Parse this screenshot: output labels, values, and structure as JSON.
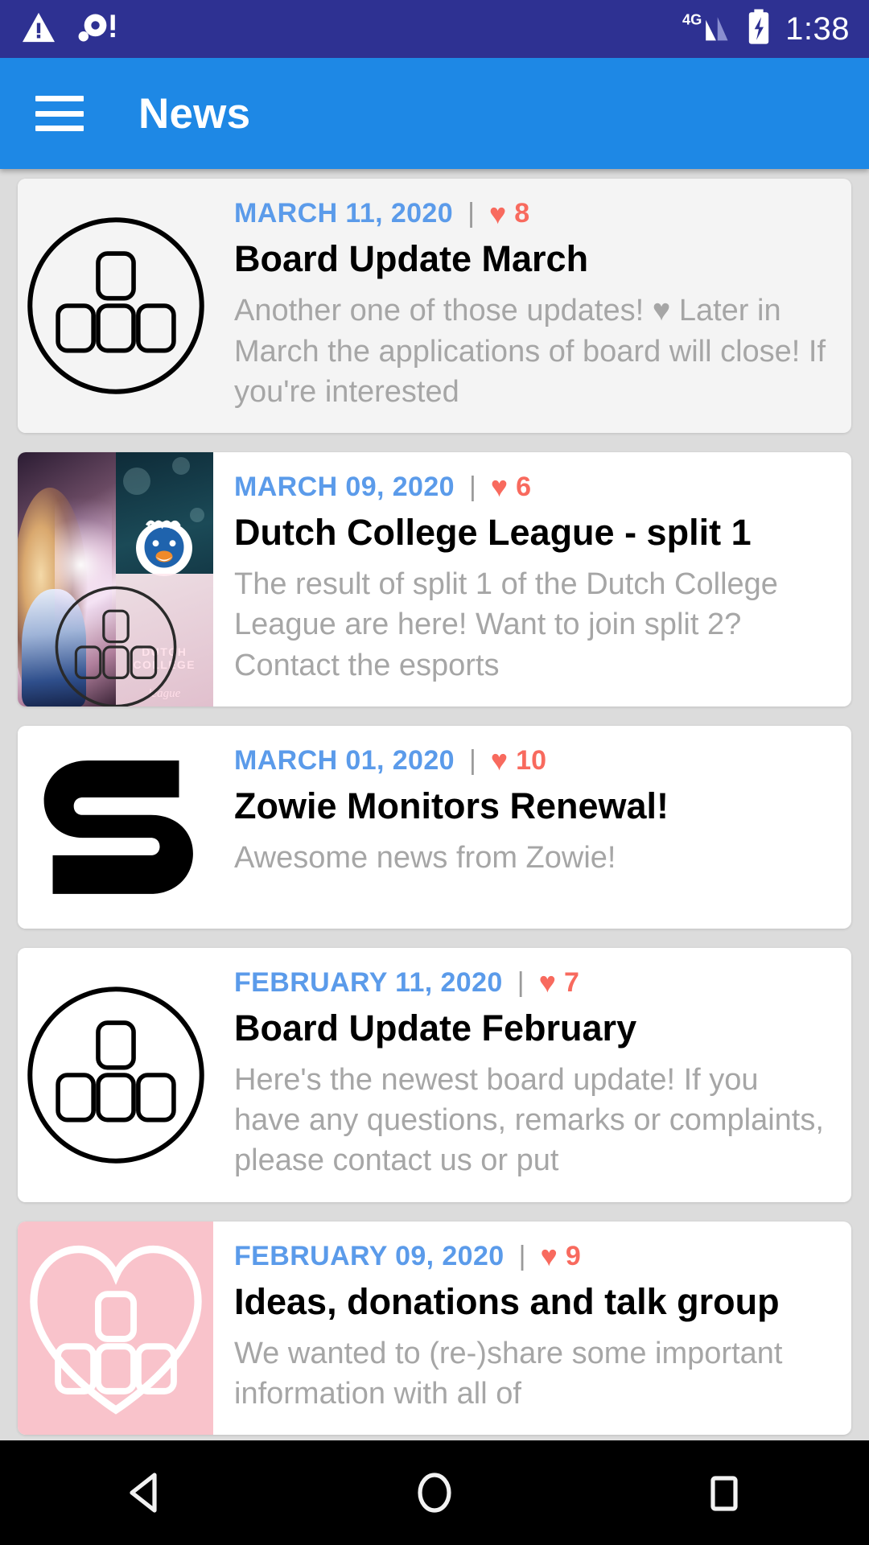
{
  "status_bar": {
    "background": "#2e3192",
    "icons": [
      "warning-triangle-icon",
      "sync-problem-icon"
    ],
    "network": "4G",
    "battery": "charging",
    "time": "1:38"
  },
  "app_bar": {
    "background": "#1e88e5",
    "menu_icon": "hamburger-menu-icon",
    "title": "News"
  },
  "colors": {
    "date": "#5b9bea",
    "heart": "#f86a5e",
    "excerpt": "#a6a6a6",
    "page_bg": "#dcdcdc"
  },
  "news": [
    {
      "date": "MARCH 11, 2020",
      "separator": "|",
      "heart": "♥",
      "likes": "8",
      "title": "Board Update March",
      "excerpt": "Another one of those updates! ♥ Later in March the applications of board will close! If you're interested",
      "thumb": "board-logo-circle"
    },
    {
      "date": "MARCH 09, 2020",
      "separator": "|",
      "heart": "♥",
      "likes": "6",
      "title": "Dutch College League - split 1",
      "excerpt": "The result of split 1 of the Dutch College League are here! Want to join split 2? Contact the esports",
      "thumb": "dutch-college-league-image",
      "thumb_text": {
        "main": "DUTCH COLLEGE",
        "sub": "league"
      }
    },
    {
      "date": "MARCH 01, 2020",
      "separator": "|",
      "heart": "♥",
      "likes": "10",
      "title": "Zowie Monitors Renewal!",
      "excerpt": "Awesome news from Zowie!",
      "thumb": "zowie-logo"
    },
    {
      "date": "FEBRUARY 11, 2020",
      "separator": "|",
      "heart": "♥",
      "likes": "7",
      "title": "Board Update February",
      "excerpt": "Here's the newest board update! If you have any questions, remarks or complaints, please contact us or put",
      "thumb": "board-logo-circle"
    },
    {
      "date": "FEBRUARY 09, 2020",
      "separator": "|",
      "heart": "♥",
      "likes": "9",
      "title": "Ideas, donations and talk group",
      "excerpt": "We wanted to (re-)share some important information with all of",
      "thumb": "heart-logo-pink"
    }
  ],
  "nav_bar": {
    "back": "back-triangle-icon",
    "home": "home-circle-icon",
    "recents": "recents-square-icon"
  }
}
